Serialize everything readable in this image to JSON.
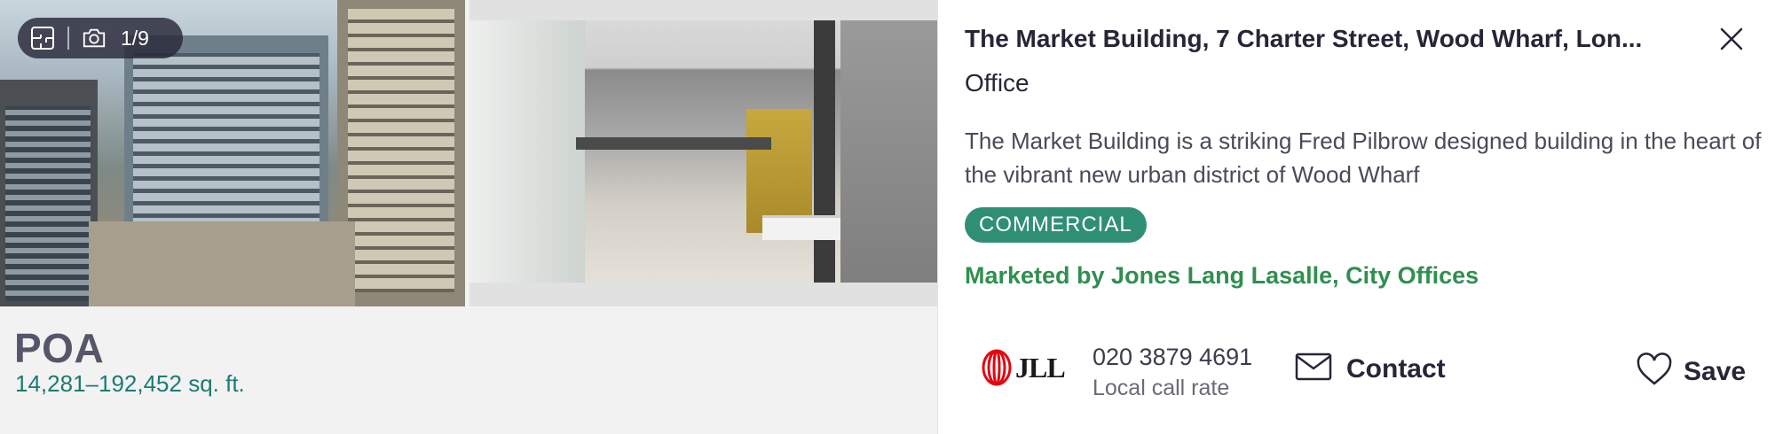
{
  "gallery": {
    "counter": "1/9"
  },
  "listing": {
    "price": "POA",
    "area": "14,281–192,452 sq. ft.",
    "title": "The Market Building, 7 Charter Street, Wood Wharf, Lon...",
    "type": "Office",
    "description": "The Market Building is a striking Fred Pilbrow designed building in the heart of the vibrant new urban district of Wood Wharf",
    "tag": "COMMERCIAL",
    "marketed_by": "Marketed by Jones Lang Lasalle, City Offices"
  },
  "agent": {
    "logo_text": "JLL",
    "phone": "020 3879 4691",
    "call_rate": "Local call rate"
  },
  "actions": {
    "contact_label": "Contact",
    "save_label": "Save"
  },
  "colors": {
    "accent_green": "#2f8f76",
    "marketed_green": "#2f8f50",
    "area_teal": "#1d7a75",
    "logo_red": "#e30613"
  },
  "icons": [
    "floorplan-icon",
    "camera-icon",
    "close-icon",
    "jll-logo",
    "mail-icon",
    "heart-icon"
  ]
}
